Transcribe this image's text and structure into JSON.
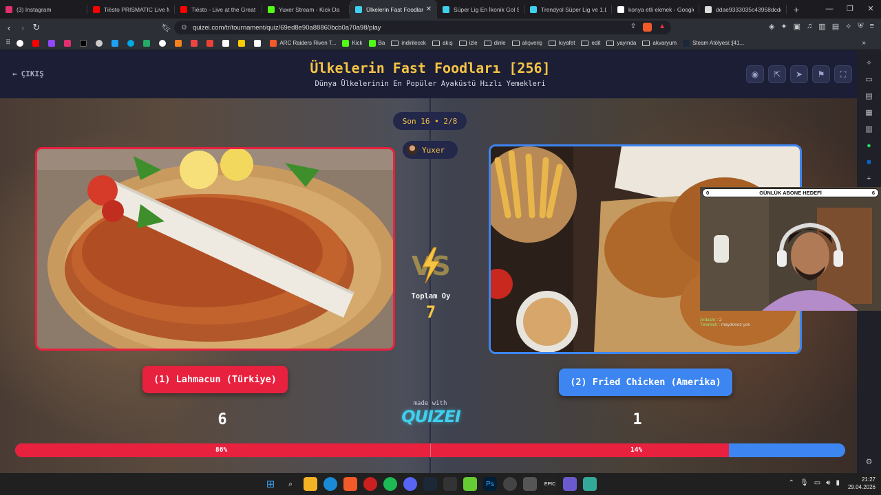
{
  "browser": {
    "tabs": [
      {
        "label": "(3) Instagram",
        "color": "#e1306c",
        "active": false
      },
      {
        "label": "Tiësto PRISMATIC Live Me",
        "color": "#ff0000",
        "active": false
      },
      {
        "label": "Tiësto - Live at the Great P",
        "color": "#ff0000",
        "active": false
      },
      {
        "label": "Yuxer Stream - Kick Da",
        "color": "#53fc18",
        "active": false
      },
      {
        "label": "Ülkelerin Fast Foodlar",
        "color": "#3fd0ee",
        "active": true
      },
      {
        "label": "Süper Lig En İkonik Gol Se",
        "color": "#3fd0ee",
        "active": false
      },
      {
        "label": "Trendyol Süper Lig ve 1.Li",
        "color": "#3fd0ee",
        "active": false
      },
      {
        "label": "konya etli ekmek - Google",
        "color": "#ffffff",
        "active": false
      },
      {
        "label": "ddae9333035c43958dcdd",
        "color": "#dddddd",
        "active": false
      }
    ],
    "url": "quizei.com/tr/tournament/quiz/69ed8e90a88860bcb0a70a98/play",
    "bookmarks": [
      {
        "label": "ARC Raiders Riven T...",
        "type": "site",
        "color": "#f25a29"
      },
      {
        "label": "Kick",
        "type": "site",
        "color": "#53fc18"
      },
      {
        "label": "Ba",
        "type": "site",
        "color": "#53fc18"
      },
      {
        "label": "indirilecek",
        "type": "folder"
      },
      {
        "label": "akış",
        "type": "folder"
      },
      {
        "label": "izle",
        "type": "folder"
      },
      {
        "label": "dinle",
        "type": "folder"
      },
      {
        "label": "alışveriş",
        "type": "folder"
      },
      {
        "label": "kıyafet",
        "type": "folder"
      },
      {
        "label": "edit",
        "type": "folder"
      },
      {
        "label": "yayında",
        "type": "folder"
      },
      {
        "label": "akvaryum",
        "type": "folder"
      },
      {
        "label": "Steam Atölyesi::[41...",
        "type": "site",
        "color": "#1b2838"
      }
    ]
  },
  "quiz": {
    "exit_label": "ÇIKIŞ",
    "title": "Ülkelerin Fast Foodları [256]",
    "subtitle": "Dünya Ülkelerinin En Popüler Ayaküstü Hızlı Yemekleri",
    "round": "Son 16 • 2/8",
    "user_name": "Yuxer",
    "total_label": "Toplam Oy",
    "total_value": "7",
    "left": {
      "label": "(1) Lahmacun (Türkiye)",
      "votes": "6",
      "percent_label": "86%",
      "percent": 86
    },
    "right": {
      "label": "(2) Fried Chicken (Amerika)",
      "votes": "1",
      "percent_label": "14%",
      "percent": 14
    },
    "made_with": "made with",
    "logo": "QUIZEI",
    "colors": {
      "red": "#e8213f",
      "blue": "#3d86f2",
      "gold": "#f6c445",
      "bg": "#1b1e35"
    }
  },
  "overlay": {
    "goal_min": "0",
    "goal_label": "GÜNLÜK ABONE HEDEFİ",
    "goal_max": "6",
    "chat": [
      {
        "user": "Ardasfe",
        "msg": "2"
      },
      {
        "user": "Tworkick",
        "msg": "maydonoz yok"
      }
    ]
  },
  "taskbar": {
    "time": "21:27",
    "date": "29.04.2026"
  }
}
